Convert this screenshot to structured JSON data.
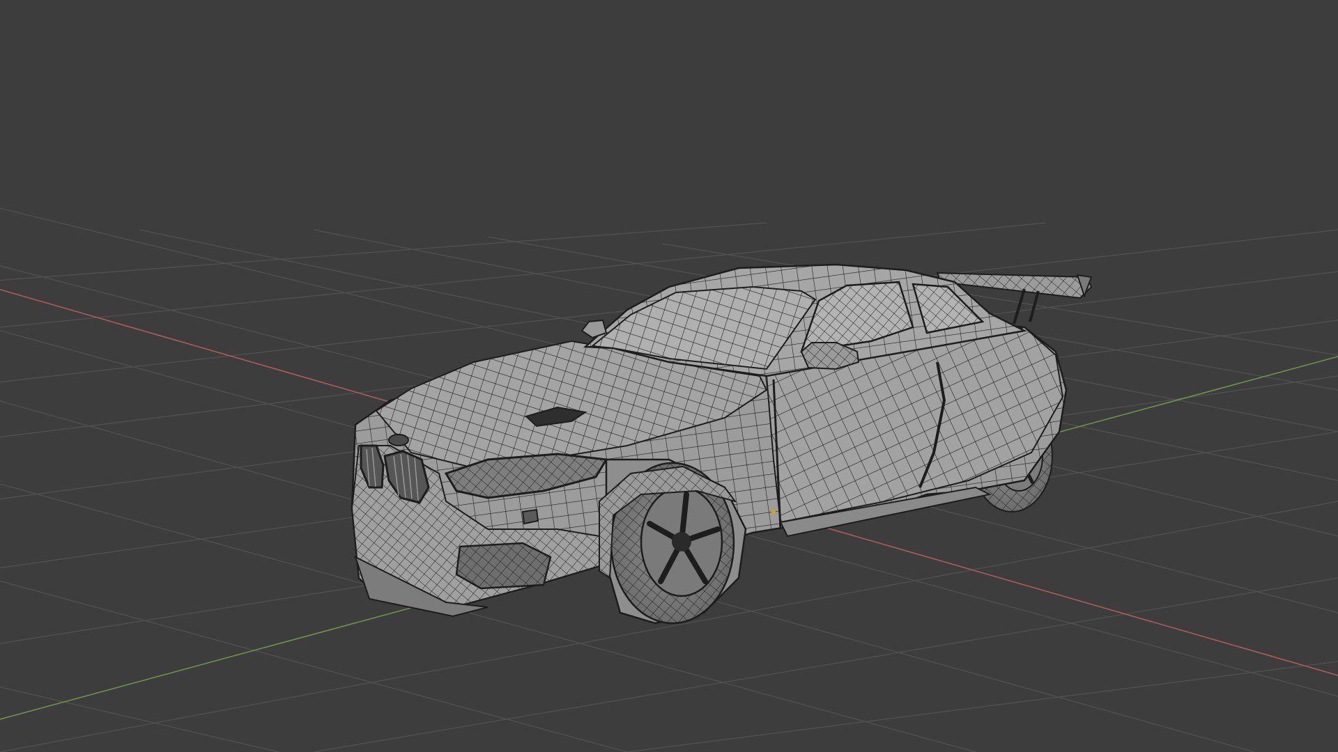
{
  "viewport": {
    "mode": "wireframe",
    "background_color": "#3d3d3d",
    "grid_color": "#525252",
    "x_axis_color": "#b05a5a",
    "y_axis_color": "#6f9246",
    "model_fill_color": "#9c9c9c",
    "wire_color": "#1d1d1d",
    "origin_marker_color": "#e0a000"
  },
  "scene": {
    "object": "car-wireframe-model",
    "grid_visible": true,
    "axes_visible": [
      "x",
      "y"
    ]
  }
}
